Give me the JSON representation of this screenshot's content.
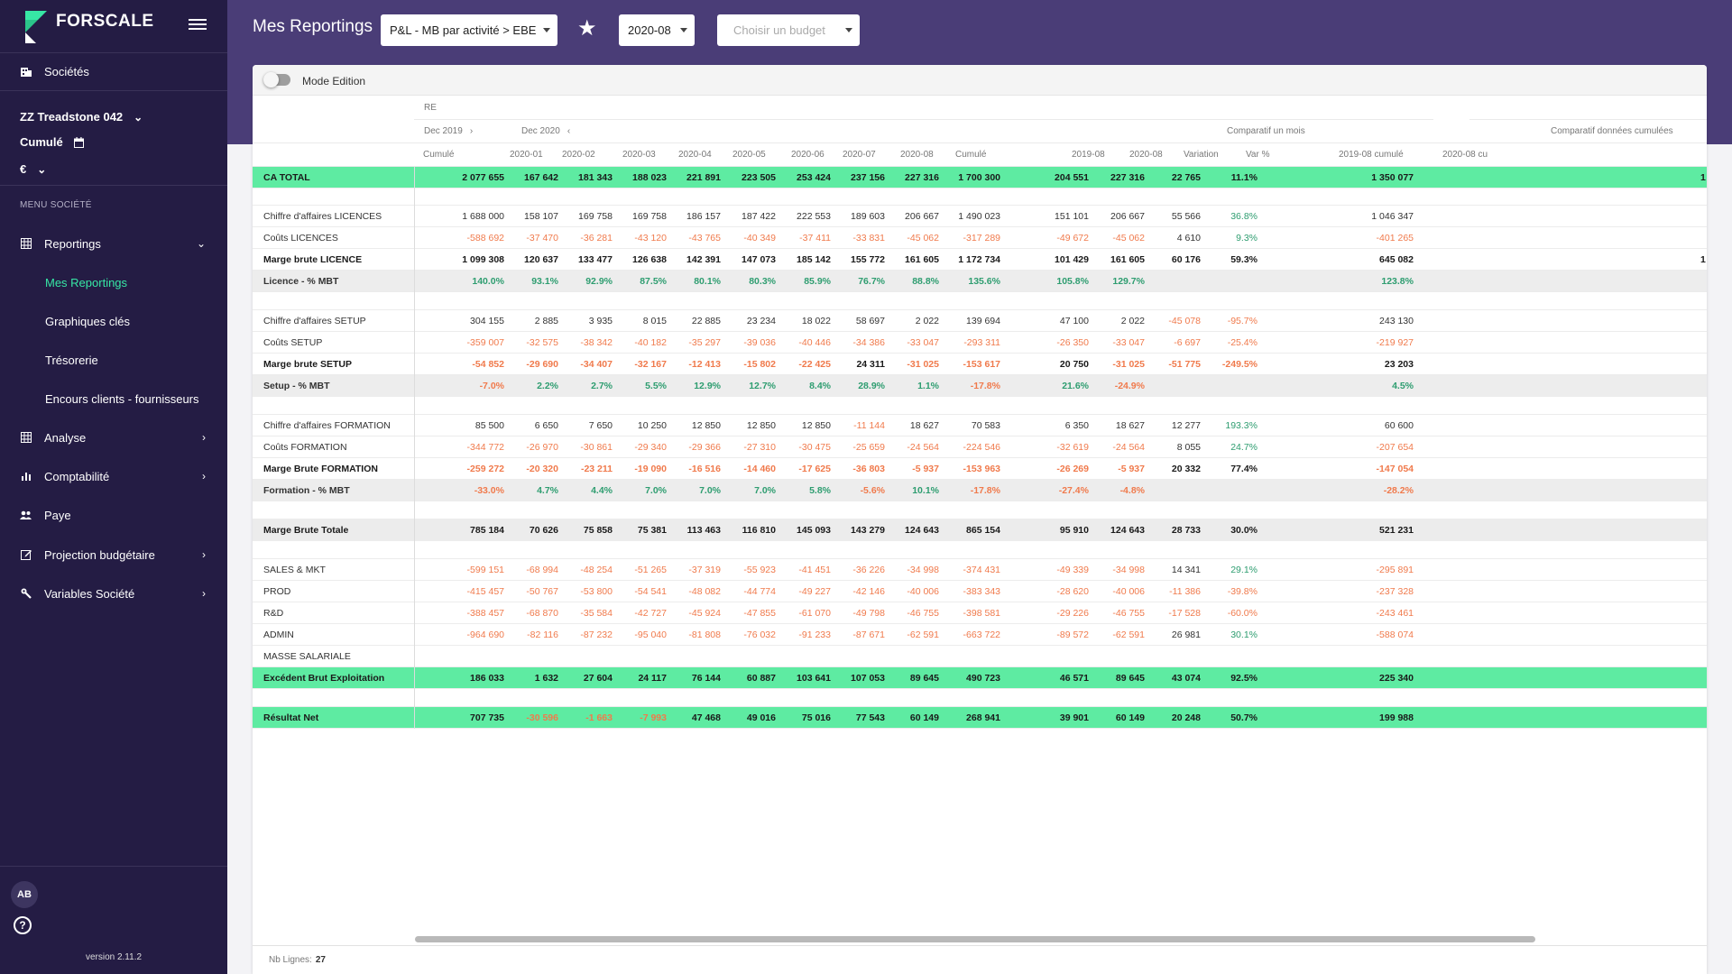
{
  "app": {
    "logo": "FORSCALE",
    "version": "version 2.11.2",
    "avatar": "AB"
  },
  "colors": {
    "sidebar": "#241c44",
    "topbar": "#4a3d77",
    "accent": "#37e7a5",
    "highlight_row": "#5eeba2",
    "negative": "#f07a4c",
    "positive_pct": "#2e9d70"
  },
  "sidebar": {
    "societes": "Sociétés",
    "company": "ZZ Treadstone 042",
    "period": "Cumulé",
    "currency": "€",
    "menu_label": "MENU SOCIÉTÉ",
    "items": [
      {
        "label": "Reportings",
        "icon": "table-icon",
        "chevron": "⌄"
      },
      {
        "label": "Mes Reportings",
        "active": true
      },
      {
        "label": "Graphiques clés"
      },
      {
        "label": "Trésorerie"
      },
      {
        "label": "Encours clients - fournisseurs"
      },
      {
        "label": "Analyse",
        "icon": "table-icon",
        "chevron": "›"
      },
      {
        "label": "Comptabilité",
        "icon": "bar-chart-icon",
        "chevron": "›"
      },
      {
        "label": "Paye",
        "icon": "people-icon"
      },
      {
        "label": "Projection budgétaire",
        "icon": "edit-icon",
        "chevron": "›"
      },
      {
        "label": "Variables Société",
        "icon": "wrench-icon",
        "chevron": "›"
      }
    ]
  },
  "header": {
    "title": "Mes Reportings",
    "report_select": "P&L - MB par activité > EBE",
    "period_select": "2020-08",
    "budget_placeholder": "Choisir un budget"
  },
  "panel": {
    "mode_label": "Mode Edition",
    "nb_lines_label": "Nb Lignes:",
    "nb_lines": "27"
  },
  "table": {
    "group_label": "RE",
    "sub_left": "Dec 2019",
    "sub_right": "Dec 2020",
    "comp_month": "Comparatif un mois",
    "comp_cum": "Comparatif données cumulées",
    "columns": [
      "Cumulé",
      "2020-01",
      "2020-02",
      "2020-03",
      "2020-04",
      "2020-05",
      "2020-06",
      "2020-07",
      "2020-08",
      "Cumulé",
      "2019-08",
      "2020-08",
      "Variation",
      "Var %",
      "2019-08 cumulé",
      "2020-08 cu"
    ],
    "rows": [
      {
        "label": "CA TOTAL",
        "type": "hl",
        "values": [
          "2 077 655",
          "167 642",
          "181 343",
          "188 023",
          "221 891",
          "223 505",
          "253 424",
          "237 156",
          "227 316",
          "1 700 300",
          "204 551",
          "227 316",
          "22 765",
          "11.1%",
          "1 350 077",
          "1"
        ]
      },
      {
        "label": "",
        "type": "empty",
        "values": []
      },
      {
        "label": "Chiffre d'affaires LICENCES",
        "type": "normal",
        "values": [
          "1 688 000",
          "158 107",
          "169 758",
          "169 758",
          "186 157",
          "187 422",
          "222 553",
          "189 603",
          "206 667",
          "1 490 023",
          "151 101",
          "206 667",
          "55 566",
          "36.8%",
          "1 046 347",
          ""
        ]
      },
      {
        "label": "Coûts LICENCES",
        "type": "normal",
        "values": [
          "-588 692",
          "-37 470",
          "-36 281",
          "-43 120",
          "-43 765",
          "-40 349",
          "-37 411",
          "-33 831",
          "-45 062",
          "-317 289",
          "-49 672",
          "-45 062",
          "4 610",
          "9.3%",
          "-401 265",
          ""
        ]
      },
      {
        "label": "Marge brute LICENCE",
        "type": "bold",
        "values": [
          "1 099 308",
          "120 637",
          "133 477",
          "126 638",
          "142 391",
          "147 073",
          "185 142",
          "155 772",
          "161 605",
          "1 172 734",
          "101 429",
          "161 605",
          "60 176",
          "59.3%",
          "645 082",
          "1"
        ]
      },
      {
        "label": "Licence - % MBT",
        "type": "pct",
        "values": [
          "140.0%",
          "93.1%",
          "92.9%",
          "87.5%",
          "80.1%",
          "80.3%",
          "85.9%",
          "76.7%",
          "88.8%",
          "135.6%",
          "105.8%",
          "129.7%",
          "",
          "",
          "123.8%",
          ""
        ]
      },
      {
        "label": "",
        "type": "empty",
        "values": []
      },
      {
        "label": "Chiffre d'affaires SETUP",
        "type": "normal",
        "values": [
          "304 155",
          "2 885",
          "3 935",
          "8 015",
          "22 885",
          "23 234",
          "18 022",
          "58 697",
          "2 022",
          "139 694",
          "47 100",
          "2 022",
          "-45 078",
          "-95.7%",
          "243 130",
          ""
        ]
      },
      {
        "label": "Coûts SETUP",
        "type": "normal",
        "values": [
          "-359 007",
          "-32 575",
          "-38 342",
          "-40 182",
          "-35 297",
          "-39 036",
          "-40 446",
          "-34 386",
          "-33 047",
          "-293 311",
          "-26 350",
          "-33 047",
          "-6 697",
          "-25.4%",
          "-219 927",
          ""
        ]
      },
      {
        "label": "Marge brute SETUP",
        "type": "bold",
        "values": [
          "-54 852",
          "-29 690",
          "-34 407",
          "-32 167",
          "-12 413",
          "-15 802",
          "-22 425",
          "24 311",
          "-31 025",
          "-153 617",
          "20 750",
          "-31 025",
          "-51 775",
          "-249.5%",
          "23 203",
          ""
        ]
      },
      {
        "label": "Setup - % MBT",
        "type": "pct",
        "values": [
          "-7.0%",
          "2.2%",
          "2.7%",
          "5.5%",
          "12.9%",
          "12.7%",
          "8.4%",
          "28.9%",
          "1.1%",
          "-17.8%",
          "21.6%",
          "-24.9%",
          "",
          "",
          "4.5%",
          ""
        ]
      },
      {
        "label": "",
        "type": "empty",
        "values": []
      },
      {
        "label": "Chiffre d'affaires FORMATION",
        "type": "normal",
        "values": [
          "85 500",
          "6 650",
          "7 650",
          "10 250",
          "12 850",
          "12 850",
          "12 850",
          "-11 144",
          "18 627",
          "70 583",
          "6 350",
          "18 627",
          "12 277",
          "193.3%",
          "60 600",
          ""
        ]
      },
      {
        "label": "Coûts FORMATION",
        "type": "normal",
        "values": [
          "-344 772",
          "-26 970",
          "-30 861",
          "-29 340",
          "-29 366",
          "-27 310",
          "-30 475",
          "-25 659",
          "-24 564",
          "-224 546",
          "-32 619",
          "-24 564",
          "8 055",
          "24.7%",
          "-207 654",
          ""
        ]
      },
      {
        "label": "Marge Brute FORMATION",
        "type": "bold",
        "values": [
          "-259 272",
          "-20 320",
          "-23 211",
          "-19 090",
          "-16 516",
          "-14 460",
          "-17 625",
          "-36 803",
          "-5 937",
          "-153 963",
          "-26 269",
          "-5 937",
          "20 332",
          "77.4%",
          "-147 054",
          ""
        ]
      },
      {
        "label": "Formation - % MBT",
        "type": "pct",
        "values": [
          "-33.0%",
          "4.7%",
          "4.4%",
          "7.0%",
          "7.0%",
          "7.0%",
          "5.8%",
          "-5.6%",
          "10.1%",
          "-17.8%",
          "-27.4%",
          "-4.8%",
          "",
          "",
          "-28.2%",
          ""
        ]
      },
      {
        "label": "",
        "type": "empty",
        "values": []
      },
      {
        "label": "Marge Brute Totale",
        "type": "total",
        "values": [
          "785 184",
          "70 626",
          "75 858",
          "75 381",
          "113 463",
          "116 810",
          "145 093",
          "143 279",
          "124 643",
          "865 154",
          "95 910",
          "124 643",
          "28 733",
          "30.0%",
          "521 231",
          ""
        ]
      },
      {
        "label": "",
        "type": "empty",
        "values": []
      },
      {
        "label": "SALES & MKT",
        "type": "normal",
        "values": [
          "-599 151",
          "-68 994",
          "-48 254",
          "-51 265",
          "-37 319",
          "-55 923",
          "-41 451",
          "-36 226",
          "-34 998",
          "-374 431",
          "-49 339",
          "-34 998",
          "14 341",
          "29.1%",
          "-295 891",
          ""
        ]
      },
      {
        "label": "PROD",
        "type": "normal",
        "values": [
          "-415 457",
          "-50 767",
          "-53 800",
          "-54 541",
          "-48 082",
          "-44 774",
          "-49 227",
          "-42 146",
          "-40 006",
          "-383 343",
          "-28 620",
          "-40 006",
          "-11 386",
          "-39.8%",
          "-237 328",
          ""
        ]
      },
      {
        "label": "R&D",
        "type": "normal",
        "values": [
          "-388 457",
          "-68 870",
          "-35 584",
          "-42 727",
          "-45 924",
          "-47 855",
          "-61 070",
          "-49 798",
          "-46 755",
          "-398 581",
          "-29 226",
          "-46 755",
          "-17 528",
          "-60.0%",
          "-243 461",
          ""
        ]
      },
      {
        "label": "ADMIN",
        "type": "normal",
        "values": [
          "-964 690",
          "-82 116",
          "-87 232",
          "-95 040",
          "-81 808",
          "-76 032",
          "-91 233",
          "-87 671",
          "-62 591",
          "-663 722",
          "-89 572",
          "-62 591",
          "26 981",
          "30.1%",
          "-588 074",
          ""
        ]
      },
      {
        "label": "MASSE SALARIALE",
        "type": "normal",
        "values": []
      },
      {
        "label": "Excédent Brut Exploitation",
        "type": "hl",
        "values": [
          "186 033",
          "1 632",
          "27 604",
          "24 117",
          "76 144",
          "60 887",
          "103 641",
          "107 053",
          "89 645",
          "490 723",
          "46 571",
          "89 645",
          "43 074",
          "92.5%",
          "225 340",
          ""
        ]
      },
      {
        "label": "",
        "type": "empty",
        "values": []
      },
      {
        "label": "Résultat Net",
        "type": "hl",
        "values": [
          "707 735",
          "-30 596",
          "-1 663",
          "-7 993",
          "47 468",
          "49 016",
          "75 016",
          "77 543",
          "60 149",
          "268 941",
          "39 901",
          "60 149",
          "20 248",
          "50.7%",
          "199 988",
          ""
        ]
      }
    ]
  }
}
